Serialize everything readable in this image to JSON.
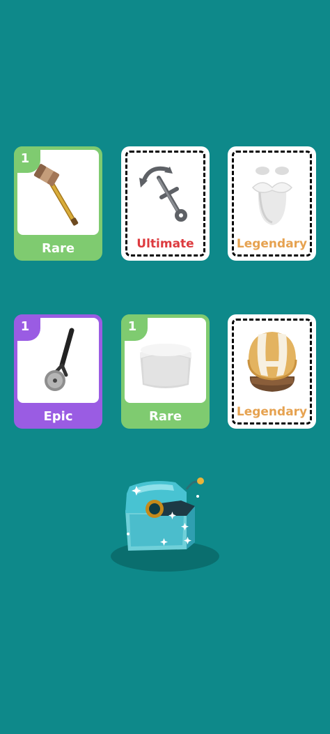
{
  "colors": {
    "background": "#0e898a",
    "rare": "#7fcb70",
    "epic": "#9a5ce3",
    "ultimate": "#dd3b3f",
    "legendary": "#e6a250"
  },
  "cards": [
    {
      "rarity": "Rare",
      "count": "1",
      "item_icon": "mallet-icon"
    },
    {
      "rarity": "Ultimate",
      "item_icon": "anchor-icon"
    },
    {
      "rarity": "Legendary",
      "item_icon": "beard-icon"
    },
    {
      "rarity": "Epic",
      "count": "1",
      "item_icon": "pizza-cutter-icon"
    },
    {
      "rarity": "Rare",
      "count": "1",
      "item_icon": "sailor-hat-icon"
    },
    {
      "rarity": "Legendary",
      "item_icon": "helmet-icon"
    }
  ],
  "reward_chest": {
    "icon": "treasure-chest-icon"
  }
}
